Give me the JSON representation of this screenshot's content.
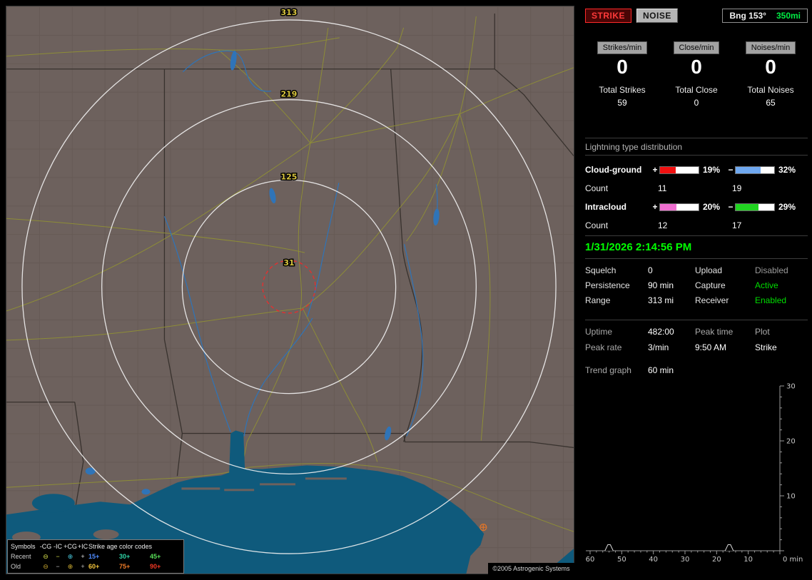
{
  "map": {
    "rings": [
      {
        "label": "313"
      },
      {
        "label": "219"
      },
      {
        "label": "125"
      },
      {
        "label": "31"
      }
    ],
    "copyright": "©2005 Astrogenic Systems",
    "legend": {
      "header_symbols": "Symbols",
      "columns": [
        "-CG",
        "-IC",
        "+CG",
        "+IC"
      ],
      "header_ages": "Strike age color codes",
      "rows": [
        {
          "label": "Recent",
          "symbols": [
            {
              "glyph": "⊖",
              "style": "color:#d6de4a"
            },
            {
              "glyph": "−",
              "style": "color:#d6de4a"
            },
            {
              "glyph": "⊕",
              "style": "color:#49c8dc"
            },
            {
              "glyph": "+",
              "style": "color:#e0e0e0"
            }
          ],
          "ages": [
            {
              "text": "15+",
              "style": "color:#4f8cff"
            },
            {
              "text": "30+",
              "style": "color:#2fd6a8"
            },
            {
              "text": "45+",
              "style": "color:#58e058"
            }
          ]
        },
        {
          "label": "Old",
          "symbols": [
            {
              "glyph": "⊖",
              "style": "color:#c2a22e"
            },
            {
              "glyph": "−",
              "style": "color:#bdbdbd"
            },
            {
              "glyph": "⊕",
              "style": "color:#cfae32"
            },
            {
              "glyph": "+",
              "style": "color:#bdbdbd"
            }
          ],
          "ages": [
            {
              "text": "60+",
              "style": "color:#f2c43c"
            },
            {
              "text": "75+",
              "style": "color:#f07c28"
            },
            {
              "text": "90+",
              "style": "color:#f03824"
            }
          ]
        }
      ]
    }
  },
  "panel": {
    "strike_button": "STRIKE",
    "noise_button": "NOISE",
    "bearing_label": "Bng 153°",
    "bearing_range": "350mi",
    "accent_green": "#00ff00",
    "accent_red": "#ff3a3a",
    "counters": [
      {
        "label": "Strikes/min",
        "value": "0",
        "total_label": "Total Strikes",
        "total": "59"
      },
      {
        "label": "Close/min",
        "value": "0",
        "total_label": "Total Close",
        "total": "0"
      },
      {
        "label": "Noises/min",
        "value": "0",
        "total_label": "Total Noises",
        "total": "65"
      }
    ],
    "distribution": {
      "title": "Lightning type distribution",
      "plus_sign": "+",
      "minus_sign": "−",
      "count_label": "Count",
      "rows": [
        {
          "name": "Cloud-ground",
          "pos_pct": "19%",
          "neg_pct": "32%",
          "pos_count": "11",
          "neg_count": "19",
          "pos_color": "#f01010",
          "neg_color": "#6fa8f0",
          "pos_style": "width:41%;background:#f01010",
          "neg_style": "width:64%;background:#6fa8f0"
        },
        {
          "name": "Intracloud",
          "pos_pct": "20%",
          "neg_pct": "29%",
          "pos_count": "12",
          "neg_count": "17",
          "pos_color": "#ef6fd0",
          "neg_color": "#21d421",
          "pos_style": "width:43%;background:#ef6fd0",
          "neg_style": "width:59%;background:#21d421"
        }
      ]
    },
    "datetime": "1/31/2026 2:14:56 PM",
    "settings": [
      {
        "l1": "Squelch",
        "v1": "0",
        "l2": "Upload",
        "v2": "Disabled",
        "v2_style": "color:#9a9a9a"
      },
      {
        "l1": "Persistence",
        "v1": "90 min",
        "l2": "Capture",
        "v2": "Active",
        "v2_style": "color:#00dd00"
      },
      {
        "l1": "Range",
        "v1": "313 mi",
        "l2": "Receiver",
        "v2": "Enabled",
        "v2_style": "color:#00dd00"
      }
    ],
    "stats": {
      "uptime_label": "Uptime",
      "uptime_value": "482:00",
      "peak_time_label": "Peak time",
      "peak_time_value": "9:50 AM",
      "plot_label": "Plot",
      "plot_value": "Strike",
      "peak_rate_label": "Peak rate",
      "peak_rate_value": "3/min"
    },
    "trend": {
      "label": "Trend graph",
      "value": "60 min"
    }
  },
  "chart_data": {
    "type": "bar",
    "title": "Trend graph (strikes per minute, last 60 min)",
    "xlabel": "min",
    "ylabel": "",
    "ylim": [
      0,
      30
    ],
    "y_ticks": [
      30,
      20,
      10
    ],
    "x_range": [
      60,
      0
    ],
    "x_ticks": [
      60,
      50,
      40,
      30,
      20,
      10
    ],
    "x_zero_label": "0 min",
    "grid": false,
    "legend_position": "none",
    "series": [
      {
        "name": "Strike rate",
        "points": [
          {
            "x": 54,
            "y": 1.1
          },
          {
            "x": 16,
            "y": 1.1
          }
        ]
      }
    ]
  }
}
